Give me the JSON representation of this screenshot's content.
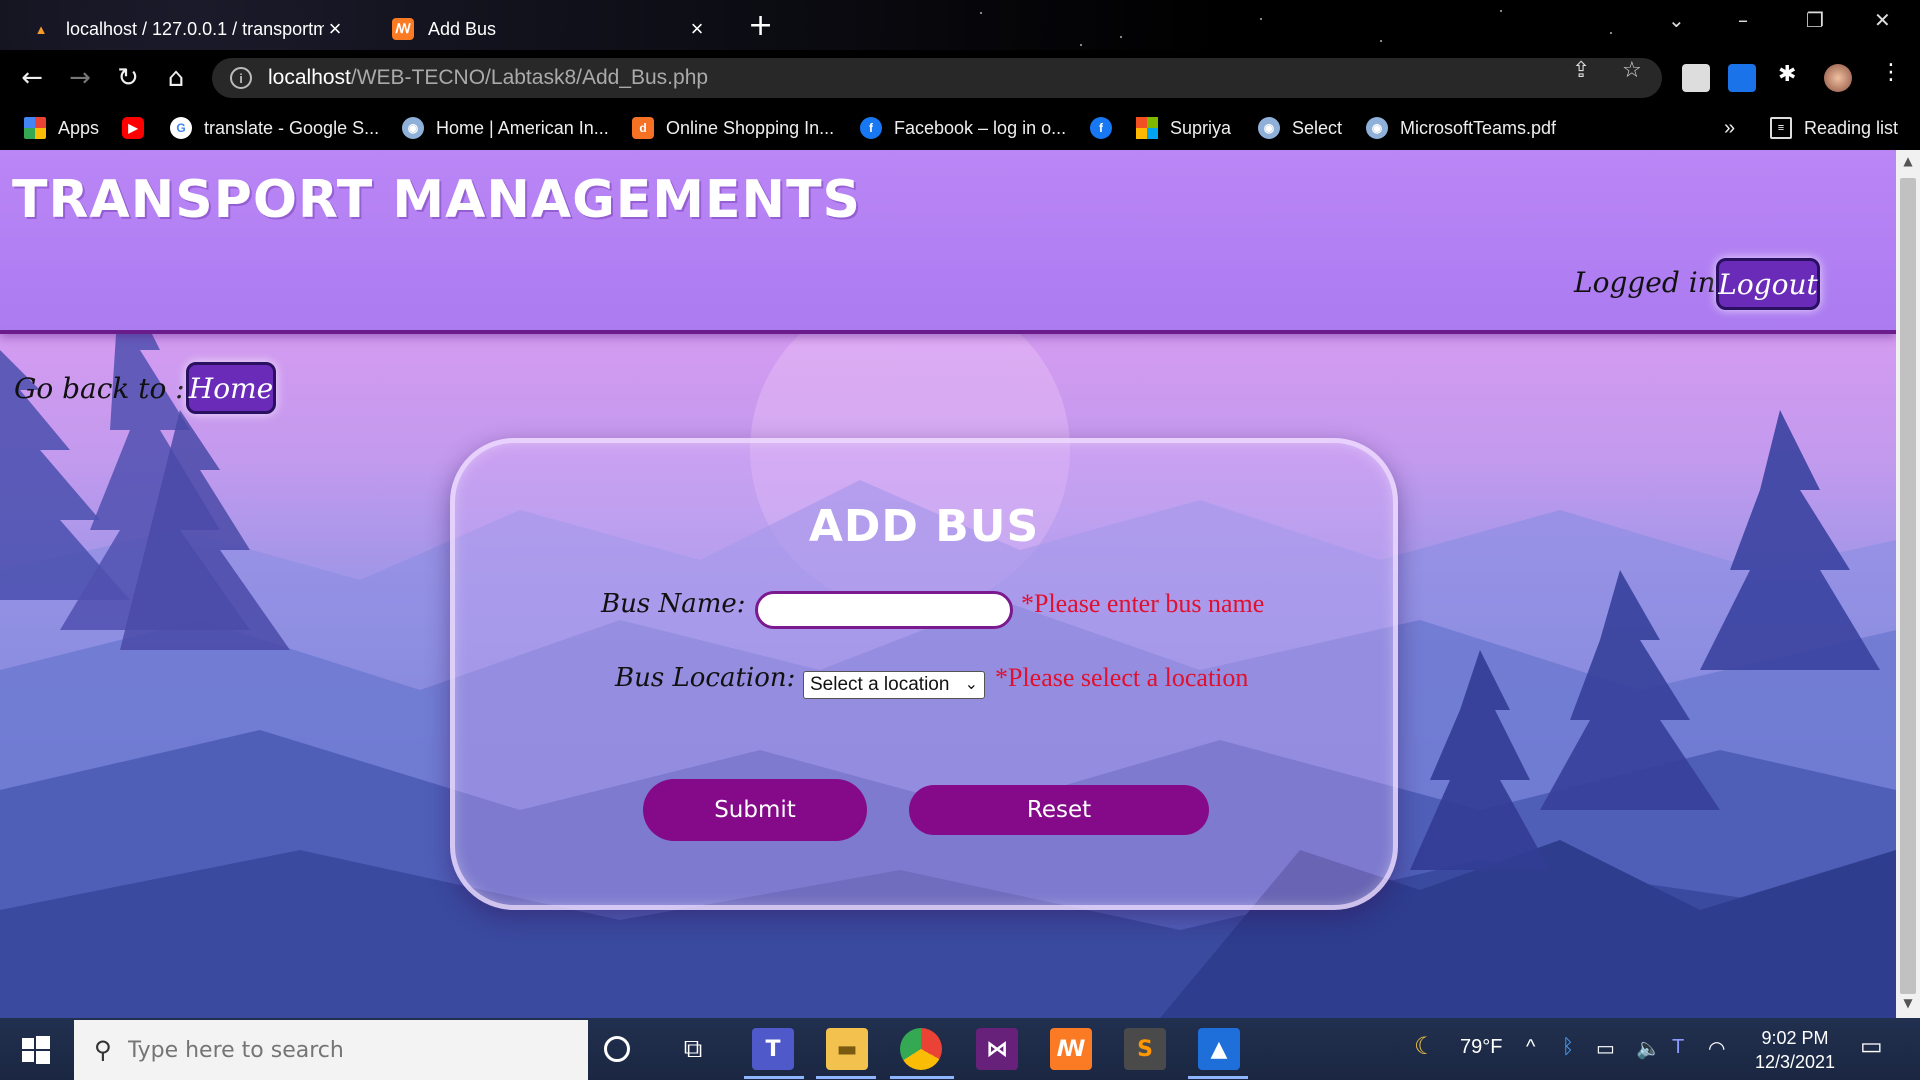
{
  "browser": {
    "tabs": [
      {
        "title": "localhost / 127.0.0.1 / transportm",
        "icon": "phpmyadmin-icon",
        "active": false
      },
      {
        "title": "Add Bus",
        "icon": "xampp-icon",
        "active": true
      }
    ],
    "address": {
      "host": "localhost",
      "path": "/WEB-TECNO/Labtask8/Add_Bus.php"
    },
    "bookmarks": [
      {
        "label": "Apps",
        "icon": "apps-grid-icon"
      },
      {
        "label": "",
        "icon": "youtube-icon"
      },
      {
        "label": "translate - Google S...",
        "icon": "google-icon"
      },
      {
        "label": "Home | American In...",
        "icon": "globe-icon"
      },
      {
        "label": "Online Shopping In...",
        "icon": "daraz-icon"
      },
      {
        "label": "Facebook – log in o...",
        "icon": "facebook-icon"
      },
      {
        "label": "",
        "icon": "facebook-icon"
      },
      {
        "label": "Supriya",
        "icon": "microsoft-icon"
      },
      {
        "label": "Select",
        "icon": "globe-icon"
      },
      {
        "label": "MicrosoftTeams.pdf",
        "icon": "globe-icon"
      }
    ],
    "bookmarks_overflow": "»",
    "reading_list": "Reading list"
  },
  "site": {
    "title": "TRANSPORT MANAGEMENTS",
    "logged_in_label": "Logged in:",
    "logout_label": "Logout",
    "go_back_label": "Go back to :",
    "home_label": "Home"
  },
  "form": {
    "title": "ADD BUS",
    "bus_name_label": "Bus Name:",
    "bus_name_value": "",
    "bus_name_error": "*Please enter bus name",
    "bus_location_label": "Bus Location:",
    "bus_location_selected": "Select a location",
    "bus_location_error": "*Please select a location",
    "submit_label": "Submit",
    "reset_label": "Reset"
  },
  "taskbar": {
    "search_placeholder": "Type here to search",
    "weather": "79°F",
    "time": "9:02 PM",
    "date": "12/3/2021"
  },
  "colors": {
    "header": "#bb86f6",
    "button_purple": "#850a8a",
    "error_red": "#e0102e",
    "logout_bg": "#6a2bb8"
  }
}
